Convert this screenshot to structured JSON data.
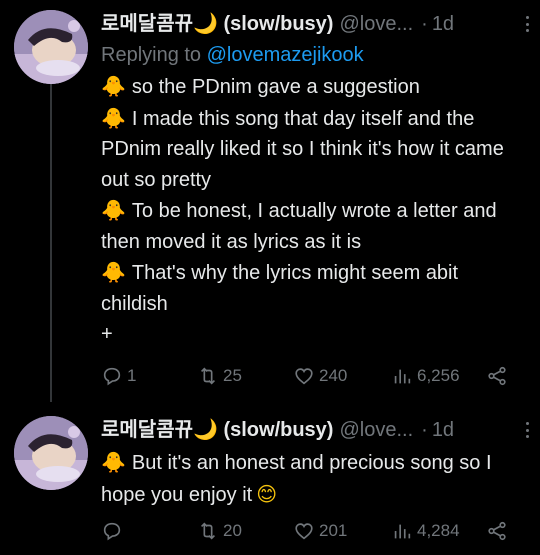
{
  "tweets": [
    {
      "display_name": "로메달콤뀨🌙 (slow/busy)",
      "handle": "@love...",
      "separator": "·",
      "time": "1d",
      "replying_label": "Replying to",
      "replying_to": "@lovemazejikook",
      "paragraphs": [
        {
          "emoji": "🐥",
          "text": "so the PDnim gave a suggestion"
        },
        {
          "emoji": "🐥",
          "text": "I made this song that day itself and the PDnim really liked it so I think it's how it came out so pretty"
        },
        {
          "emoji": "🐥",
          "text": "To be honest, I actually wrote a letter and then moved it as lyrics as it is"
        },
        {
          "emoji": "🐥",
          "text": "That's why the lyrics might seem abit childish"
        },
        {
          "emoji": "",
          "text": "+"
        }
      ],
      "actions": {
        "replies": "1",
        "retweets": "25",
        "likes": "240",
        "views": "6,256"
      }
    },
    {
      "display_name": "로메달콤뀨🌙 (slow/busy)",
      "handle": "@love...",
      "separator": "·",
      "time": "1d",
      "paragraphs": [
        {
          "emoji": "🐥",
          "text": "But it's an honest and precious song so I hope you enjoy it"
        }
      ],
      "closing_emoji": "😊",
      "actions": {
        "replies": "",
        "retweets": "20",
        "likes": "201",
        "views": "4,284"
      }
    }
  ],
  "icons": {
    "reply": "reply-icon",
    "retweet": "retweet-icon",
    "like": "heart-icon",
    "views": "views-chart-icon",
    "share": "share-icon",
    "more": "more-vertical-icon"
  },
  "colors": {
    "background": "#000000",
    "text": "#e7e9ea",
    "muted": "#71767b",
    "link": "#1d9bf0",
    "thread_line": "#333639"
  }
}
